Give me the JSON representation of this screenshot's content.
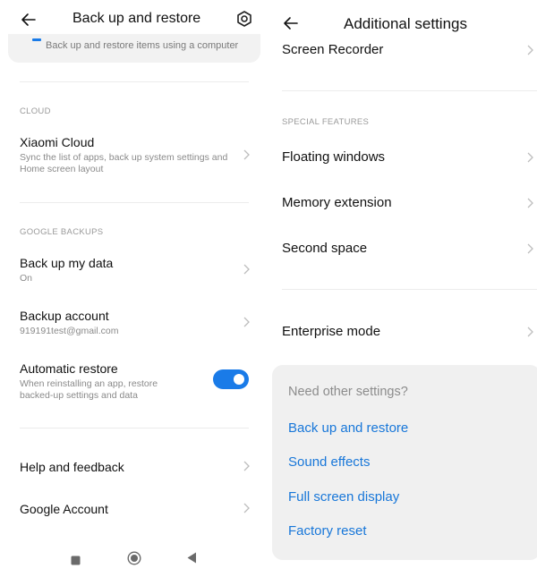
{
  "left": {
    "header": {
      "title": "Back up and restore",
      "back_icon": "arrow-left-icon",
      "settings_icon": "gear-icon"
    },
    "top_card": {
      "subtitle": "Back up and restore items using a computer",
      "icon": "computer-icon"
    },
    "sections": {
      "cloud": {
        "label": "CLOUD"
      },
      "google": {
        "label": "GOOGLE BACKUPS"
      }
    },
    "items": [
      {
        "title": "Xiaomi Cloud",
        "subtitle": "Sync the list of apps, back up system settings and Home screen layout"
      },
      {
        "title": "Back up my data",
        "subtitle": "On"
      },
      {
        "title": "Backup account",
        "subtitle": "919191test@gmail.com"
      },
      {
        "title": "Automatic restore",
        "subtitle": "When reinstalling an app, restore backed-up settings and data",
        "toggle_on": true
      },
      {
        "title": "Help and feedback"
      },
      {
        "title": "Google Account"
      }
    ],
    "navbar": {
      "recents_icon": "square-icon",
      "home_icon": "circle-icon",
      "back_icon": "triangle-back-icon"
    },
    "colors": {
      "accent": "#1a7be8"
    }
  },
  "right": {
    "header": {
      "title": "Additional settings",
      "back_icon": "arrow-left-icon"
    },
    "sections": {
      "special": {
        "label": "SPECIAL FEATURES"
      }
    },
    "items": [
      {
        "title": "Screen Recorder"
      },
      {
        "title": "Floating windows"
      },
      {
        "title": "Memory extension"
      },
      {
        "title": "Second space"
      },
      {
        "title": "Enterprise mode"
      }
    ],
    "other": {
      "title": "Need other settings?",
      "links": [
        "Back up and restore",
        "Sound effects",
        "Full screen display",
        "Factory reset"
      ]
    },
    "colors": {
      "link": "#1877d9"
    }
  }
}
